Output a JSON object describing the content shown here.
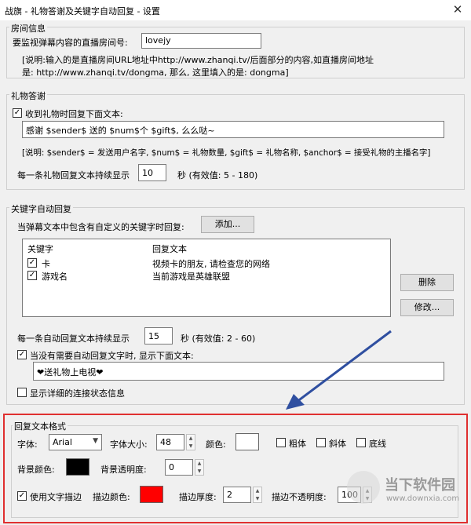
{
  "window": {
    "title": "战旗 - 礼物答谢及关键字自动回复 - 设置",
    "close_glyph": "✕"
  },
  "room": {
    "group_title": "房间信息",
    "label": "要监视弹幕内容的直播房间号:",
    "value": "lovejy",
    "note_line1": "[说明:输入的是直播房间URL地址中http://www.zhanqi.tv/后面部分的内容,如直播房间地址",
    "note_line2": "是: http://www.zhanqi.tv/dongma, 那么, 这里填入的是: dongma]"
  },
  "gift": {
    "group_title": "礼物答谢",
    "checkbox_label": "收到礼物时回复下面文本:",
    "checked": true,
    "reply_text": "感谢 $sender$ 送的 $num$个 $gift$, 么么哒~",
    "note": "[说明: $sender$ = 发送用户名字, $num$ = 礼物数量, $gift$ = 礼物名称, $anchor$ = 接受礼物的主播名字]",
    "duration_label": "每一条礼物回复文本持续显示",
    "duration_value": "10",
    "duration_unit": "秒 (有效值: 5 - 180)"
  },
  "keyword": {
    "group_title": "关键字自动回复",
    "prompt": "当弹幕文本中包含有自定义的关键字时回复:",
    "add_button": "添加...",
    "columns": {
      "keyword": "关键字",
      "reply": "回复文本"
    },
    "rows": [
      {
        "keyword": "卡",
        "reply": "视频卡的朋友, 请检查您的网络",
        "checked": true
      },
      {
        "keyword": "游戏名",
        "reply": "当前游戏是英雄联盟",
        "checked": true
      }
    ],
    "delete_button": "删除",
    "edit_button": "修改...",
    "duration_label": "每一条自动回复文本持续显示",
    "duration_value": "15",
    "duration_unit": "秒 (有效值: 2 - 60)",
    "fallback_label": "当没有需要自动回复文字时, 显示下面文本:",
    "fallback_checked": true,
    "fallback_text": "❤送礼物上电视❤",
    "detail_label": "显示详细的连接状态信息",
    "detail_checked": false
  },
  "format": {
    "group_title": "回复文本格式",
    "font_label": "字体:",
    "font_value": "Arial",
    "size_label": "字体大小:",
    "size_value": "48",
    "color_label": "颜色:",
    "color": "#ffffff",
    "bold_label": "粗体",
    "italic_label": "斜体",
    "underline_label": "底线",
    "bg_color_label": "背景颜色:",
    "bg_color": "#000000",
    "bg_alpha_label": "背景透明度:",
    "bg_alpha_value": "0",
    "stroke_label": "使用文字描边",
    "stroke_checked": true,
    "stroke_color_label": "描边颜色:",
    "stroke_color": "#ff0000",
    "stroke_width_label": "描边厚度:",
    "stroke_width_value": "2",
    "stroke_alpha_label": "描边不透明度:",
    "stroke_alpha_value": "100"
  },
  "annotation": {
    "highlight_color": "#e03030",
    "arrow_color": "#2f4fa0"
  },
  "watermark": {
    "brand": "当下软件园",
    "url": "www.downxia.com"
  }
}
